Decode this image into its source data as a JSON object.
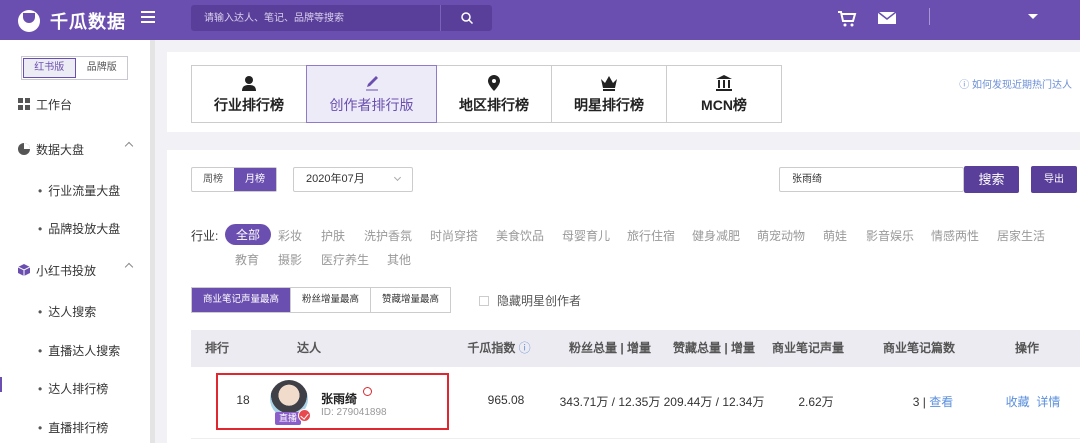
{
  "header": {
    "logo_text": "千瓜数据",
    "search_placeholder": "请输入达人、笔记、品牌等搜索"
  },
  "sidebar": {
    "version_toggle": [
      "红书版",
      "品牌版"
    ],
    "workbench": "工作台",
    "data_dashboard": "数据大盘",
    "data_dashboard_sub": [
      "行业流量大盘",
      "品牌投放大盘"
    ],
    "xhs_placement": "小红书投放",
    "xhs_placement_sub": [
      "达人搜索",
      "直播达人搜索",
      "达人排行榜",
      "直播排行榜"
    ]
  },
  "rank_tabs": [
    {
      "label": "行业排行榜",
      "icon": "user-icon"
    },
    {
      "label": "创作者排行版",
      "icon": "pen-icon"
    },
    {
      "label": "地区排行榜",
      "icon": "location-pin-icon"
    },
    {
      "label": "明星排行榜",
      "icon": "crown-icon"
    },
    {
      "label": "MCN榜",
      "icon": "institution-icon"
    }
  ],
  "help_link": "如何发现近期热门达人",
  "filters": {
    "period": [
      "周榜",
      "月榜"
    ],
    "month": "2020年07月",
    "search_value": "张雨绮",
    "search_button": "搜索",
    "export_button": "导出",
    "industry_label": "行业:",
    "industries_row1": [
      "全部",
      "彩妆",
      "护肤",
      "洗护香氛",
      "时尚穿搭",
      "美食饮品",
      "母婴育儿",
      "旅行住宿",
      "健身减肥",
      "萌宠动物",
      "萌娃",
      "影音娱乐",
      "情感两性",
      "居家生活"
    ],
    "industries_row2": [
      "教育",
      "摄影",
      "医疗养生",
      "其他"
    ],
    "metric_tabs": [
      "商业笔记声量最高",
      "粉丝增量最高",
      "赞藏增量最高"
    ],
    "hide_star": "隐藏明星创作者"
  },
  "table": {
    "headers": [
      "排行",
      "达人",
      "千瓜指数",
      "粉丝总量 | 增量",
      "赞藏总量 | 增量",
      "商业笔记声量",
      "商业笔记篇数",
      "操作"
    ],
    "row": {
      "rank": "18",
      "name": "张雨绮",
      "id": "ID:  279041898",
      "live_badge": "直播",
      "index": "965.08",
      "fans": "343.71万 / 12.35万",
      "likes": "209.44万 / 12.34万",
      "volume": "2.62万",
      "notes_count": "3",
      "notes_link": "查看",
      "action_favorite": "收藏",
      "action_detail": "详情"
    }
  },
  "colors": {
    "brand": "#6b4fb0",
    "link": "#5b8fdc",
    "highlight_box": "#e0262e"
  }
}
